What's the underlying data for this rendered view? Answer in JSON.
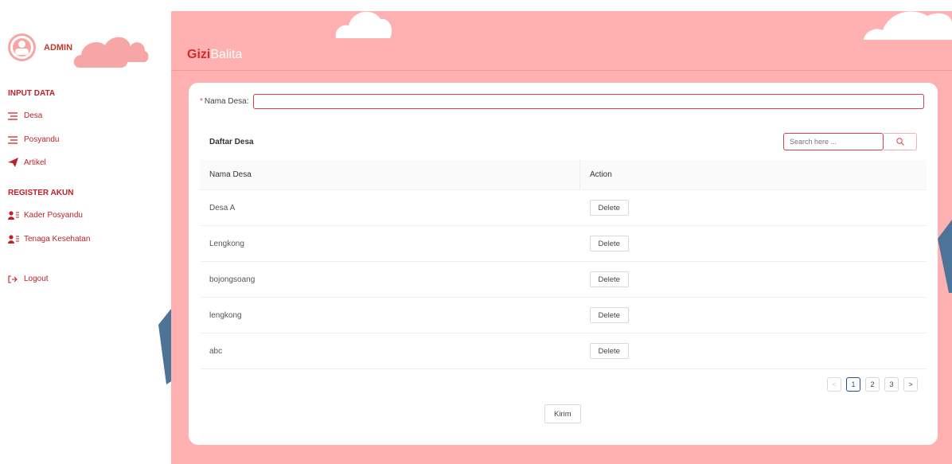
{
  "sidebar": {
    "profile_name": "ADMIN",
    "sections": {
      "input_title": "INPUT DATA",
      "register_title": "REGISTER AKUN"
    },
    "items": [
      {
        "label": "Desa",
        "icon": "list-icon"
      },
      {
        "label": "Posyandu",
        "icon": "list-icon"
      },
      {
        "label": "Artikel",
        "icon": "paper-plane-icon"
      },
      {
        "label": "Kader Posyandu",
        "icon": "user-list-icon"
      },
      {
        "label": "Tenaga Kesehatan",
        "icon": "user-list-icon"
      },
      {
        "label": "Logout",
        "icon": "logout-icon"
      }
    ]
  },
  "header": {
    "brand_bold": "Gizi",
    "brand_light": "Balita"
  },
  "form": {
    "label": "Nama Desa",
    "required_mark": "*",
    "value": ""
  },
  "list": {
    "title": "Daftar Desa",
    "search_placeholder": "Search here ...",
    "columns": [
      "Nama Desa",
      "Action"
    ],
    "rows": [
      {
        "name": "Desa A",
        "action": "Delete"
      },
      {
        "name": "Lengkong",
        "action": "Delete"
      },
      {
        "name": "bojongsoang",
        "action": "Delete"
      },
      {
        "name": "lengkong",
        "action": "Delete"
      },
      {
        "name": "abc",
        "action": "Delete"
      }
    ]
  },
  "pagination": {
    "prev": "<",
    "pages": [
      "1",
      "2",
      "3"
    ],
    "current": "1",
    "next": ">"
  },
  "submit_label": "Kirim",
  "colors": {
    "accent": "#d62828",
    "header_bg": "#ffb0b0",
    "pagination_active": "#1f4e9a"
  }
}
